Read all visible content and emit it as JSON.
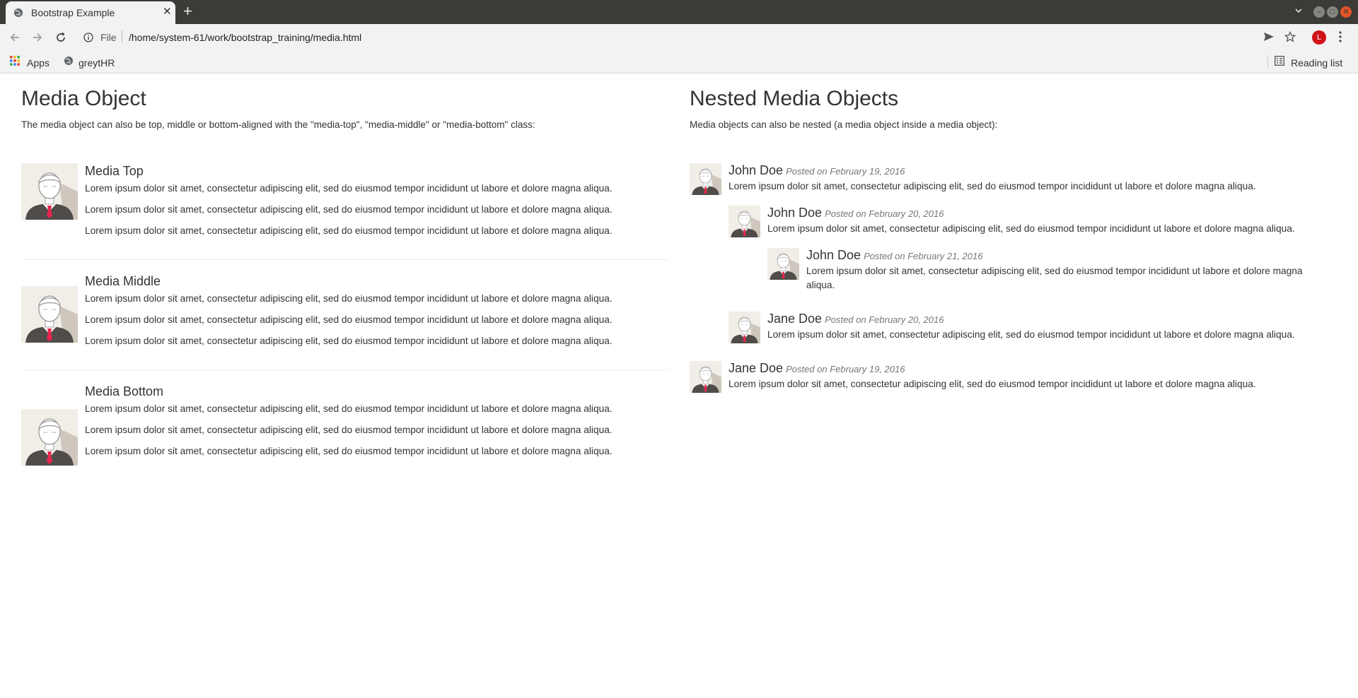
{
  "browser": {
    "tab_title": "Bootstrap Example",
    "scheme": "File",
    "url": "/home/system-61/work/bootstrap_training/media.html",
    "avatar_letter": "L",
    "bookmarks": {
      "apps": "Apps",
      "greythr": "greytHR",
      "reading_list": "Reading list"
    }
  },
  "left": {
    "title": "Media Object",
    "intro": "The media object can also be top, middle or bottom-aligned with the \"media-top\", \"media-middle\" or \"media-bottom\" class:",
    "items": [
      {
        "heading": "Media Top",
        "paragraphs": [
          "Lorem ipsum dolor sit amet, consectetur adipiscing elit, sed do eiusmod tempor incididunt ut labore et dolore magna aliqua.",
          "Lorem ipsum dolor sit amet, consectetur adipiscing elit, sed do eiusmod tempor incididunt ut labore et dolore magna aliqua.",
          "Lorem ipsum dolor sit amet, consectetur adipiscing elit, sed do eiusmod tempor incididunt ut labore et dolore magna aliqua."
        ]
      },
      {
        "heading": "Media Middle",
        "paragraphs": [
          "Lorem ipsum dolor sit amet, consectetur adipiscing elit, sed do eiusmod tempor incididunt ut labore et dolore magna aliqua.",
          "Lorem ipsum dolor sit amet, consectetur adipiscing elit, sed do eiusmod tempor incididunt ut labore et dolore magna aliqua.",
          "Lorem ipsum dolor sit amet, consectetur adipiscing elit, sed do eiusmod tempor incididunt ut labore et dolore magna aliqua."
        ]
      },
      {
        "heading": "Media Bottom",
        "paragraphs": [
          "Lorem ipsum dolor sit amet, consectetur adipiscing elit, sed do eiusmod tempor incididunt ut labore et dolore magna aliqua.",
          "Lorem ipsum dolor sit amet, consectetur adipiscing elit, sed do eiusmod tempor incididunt ut labore et dolore magna aliqua.",
          "Lorem ipsum dolor sit amet, consectetur adipiscing elit, sed do eiusmod tempor incididunt ut labore et dolore magna aliqua."
        ]
      }
    ]
  },
  "right": {
    "title": "Nested Media Objects",
    "intro": "Media objects can also be nested (a media object inside a media object):",
    "comments": [
      {
        "name": "John Doe",
        "posted": "Posted on February 19, 2016",
        "text": "Lorem ipsum dolor sit amet, consectetur adipiscing elit, sed do eiusmod tempor incididunt ut labore et dolore magna aliqua."
      },
      {
        "name": "John Doe",
        "posted": "Posted on February 20, 2016",
        "text": "Lorem ipsum dolor sit amet, consectetur adipiscing elit, sed do eiusmod tempor incididunt ut labore et dolore magna aliqua."
      },
      {
        "name": "John Doe",
        "posted": "Posted on February 21, 2016",
        "text": "Lorem ipsum dolor sit amet, consectetur adipiscing elit, sed do eiusmod tempor incididunt ut labore et dolore magna aliqua."
      },
      {
        "name": "Jane Doe",
        "posted": "Posted on February 20, 2016",
        "text": "Lorem ipsum dolor sit amet, consectetur adipiscing elit, sed do eiusmod tempor incididunt ut labore et dolore magna aliqua."
      },
      {
        "name": "Jane Doe",
        "posted": "Posted on February 19, 2016",
        "text": "Lorem ipsum dolor sit amet, consectetur adipiscing elit, sed do eiusmod tempor incididunt ut labore et dolore magna aliqua."
      }
    ]
  }
}
